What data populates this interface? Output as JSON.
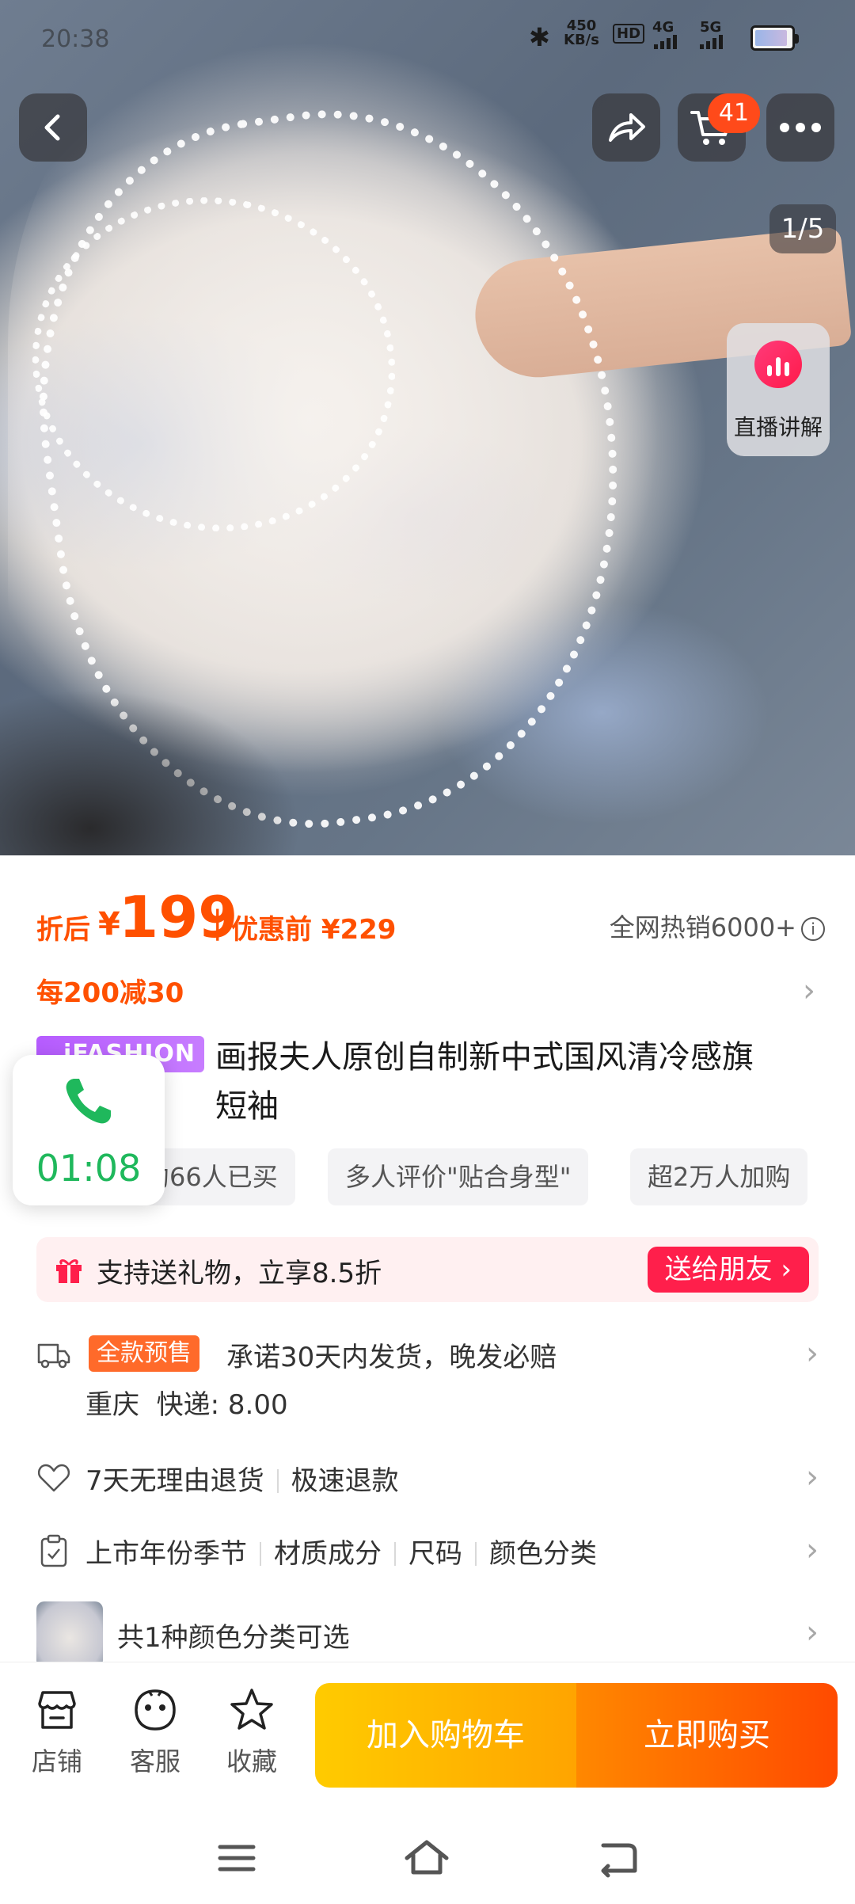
{
  "status_bar": {
    "time": "20:38",
    "speed_value": "450",
    "speed_unit": "KB/s",
    "hd_label": "HD",
    "net1": "4G",
    "net2": "5G"
  },
  "hero": {
    "cart_count": "41",
    "image_counter": "1/5",
    "live_label": "直播讲解"
  },
  "price": {
    "prefix": "折后",
    "currency": "¥",
    "value": "199",
    "separator": "|",
    "original": "优惠前 ¥229",
    "sales": "全网热销6000+"
  },
  "promo": {
    "text": "每200减30"
  },
  "title": {
    "brand_tag": "iFASHION",
    "line1": "画报夫人原创自制新中式国风清冷感旗",
    "line2": "短袖"
  },
  "tags": [
    "约66人已买",
    "多人评价\"贴合身型\"",
    "超2万人加购"
  ],
  "call_widget": {
    "timer": "01:08"
  },
  "gift": {
    "text": "支持送礼物，立享8.5折",
    "button": "送给朋友 ›"
  },
  "shipping": {
    "badge": "全款预售",
    "promise": "承诺30天内发货，晚发必赔",
    "origin": "重庆",
    "fee": "快递: 8.00"
  },
  "returns": {
    "item1": "7天无理由退货",
    "item2": "极速退款"
  },
  "params": [
    "上市年份季节",
    "材质成分",
    "尺码",
    "颜色分类"
  ],
  "variants": {
    "text": "共1种颜色分类可选"
  },
  "bottom_bar": {
    "shop": "店铺",
    "service": "客服",
    "favorite": "收藏",
    "add_to_cart": "加入购物车",
    "buy_now": "立即购买"
  },
  "colors": {
    "accent": "#ff5000",
    "gift_button": "#ff1f4b",
    "call_green": "#1fb85c",
    "cta_yellow": "#ffb800",
    "cta_orange": "#ff5a00"
  }
}
